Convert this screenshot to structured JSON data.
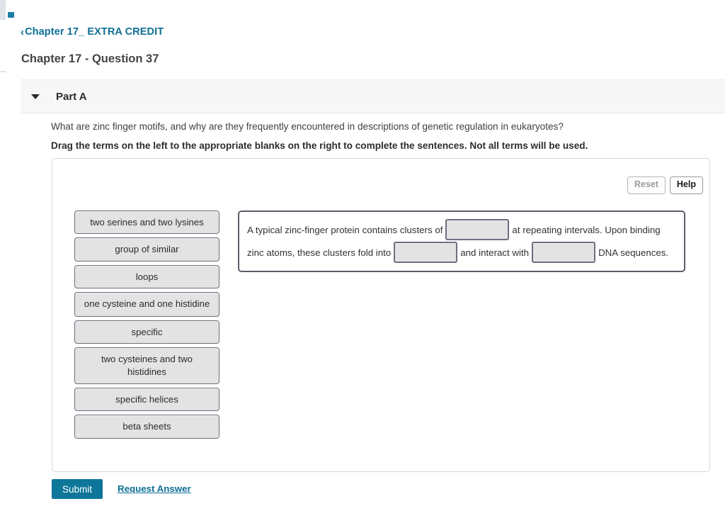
{
  "chrome": {
    "accent_color": "#0e6f96",
    "edge_marker": "teal-square"
  },
  "breadcrumb": {
    "chevron": "‹",
    "label": "Chapter 17_ EXTRA CREDIT"
  },
  "page_title": "Chapter 17 - Question 37",
  "part": {
    "caret": "caret-down-icon",
    "label": "Part A",
    "question": "What are zinc finger motifs, and why are they frequently encountered in descriptions of genetic regulation in eukaryotes?",
    "instruction": "Drag the terms on the left to the appropriate blanks on the right to complete the sentences. Not all terms will be used."
  },
  "toolbar": {
    "reset_label": "Reset",
    "reset_disabled": true,
    "help_label": "Help"
  },
  "terms": [
    {
      "label": "two serines and two lysines",
      "lines": 1
    },
    {
      "label": "group of similar",
      "lines": 1
    },
    {
      "label": "loops",
      "lines": 1
    },
    {
      "label": "one cysteine and one histidine",
      "lines": 2
    },
    {
      "label": "specific",
      "lines": 1
    },
    {
      "label": "two cysteines and two histidines",
      "lines": 2
    },
    {
      "label": "specific helices",
      "lines": 1
    },
    {
      "label": "beta sheets",
      "lines": 1
    }
  ],
  "sentence": {
    "fragments": [
      "A typical zinc-finger protein contains clusters of",
      "at repeating intervals. Upon binding zinc atoms, these clusters fold into",
      "and interact with",
      "DNA sequences."
    ],
    "blanks": [
      {
        "id": "blank-1",
        "value": ""
      },
      {
        "id": "blank-2",
        "value": ""
      },
      {
        "id": "blank-3",
        "value": ""
      }
    ]
  },
  "footer": {
    "submit_label": "Submit",
    "request_answer_label": "Request Answer"
  }
}
